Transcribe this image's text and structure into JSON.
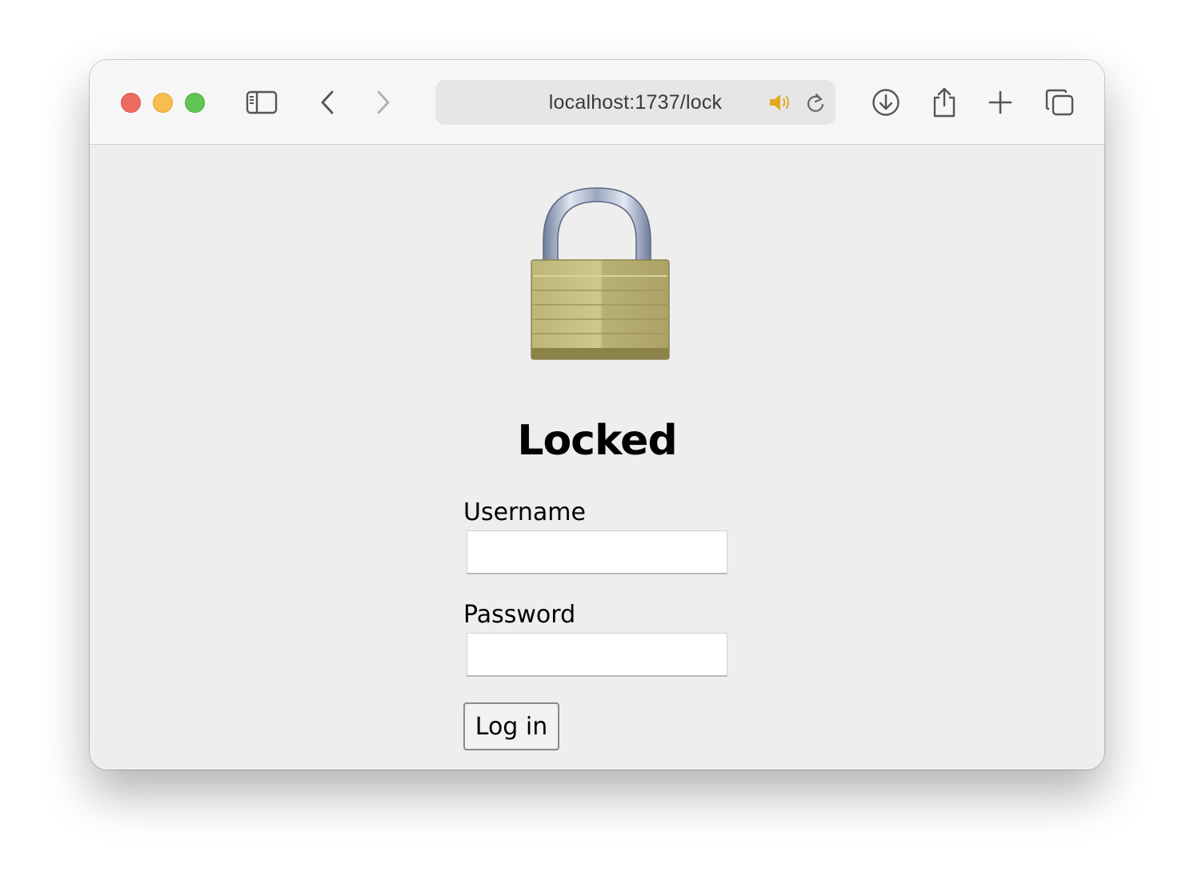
{
  "browser": {
    "url": "localhost:1737/lock",
    "traffic_lights": {
      "close": "#ee6a5f",
      "minimize": "#f5be4f",
      "zoom": "#61c554"
    },
    "icons": {
      "sidebar": "sidebar-icon",
      "back": "chevron-left-icon",
      "forward": "chevron-right-icon",
      "audio": "speaker-icon",
      "reload": "reload-icon",
      "downloads": "download-icon",
      "share": "share-icon",
      "new_tab": "plus-icon",
      "tabs": "tab-overview-icon"
    }
  },
  "page": {
    "lock_emoji": "lock-icon",
    "title": "Locked",
    "username_label": "Username",
    "username_value": "",
    "password_label": "Password",
    "password_value": "",
    "login_button": "Log in"
  }
}
